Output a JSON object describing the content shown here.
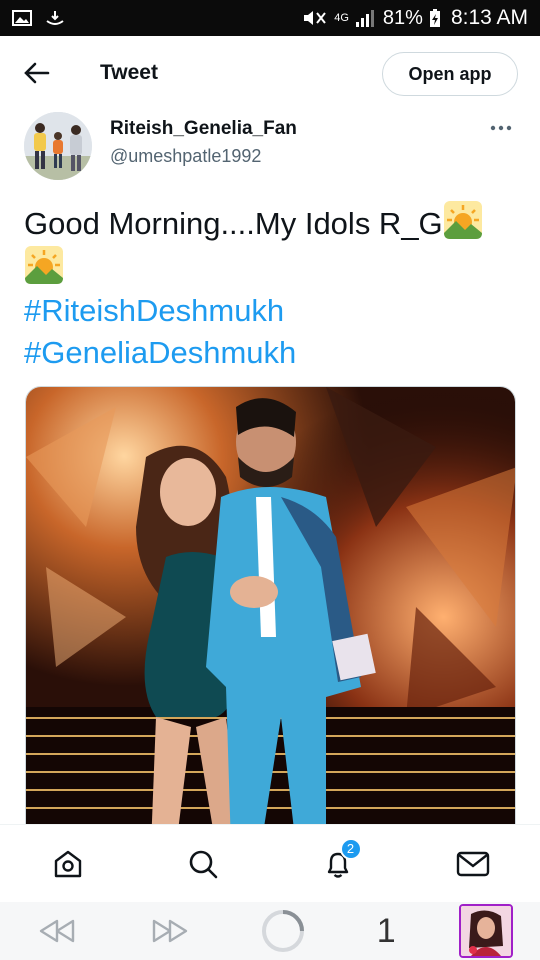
{
  "status_bar": {
    "signal_label": "4G",
    "battery_percent": "81%",
    "time": "8:13 AM"
  },
  "header": {
    "title": "Tweet",
    "open_app_label": "Open app"
  },
  "tweet": {
    "author_name": "Riteish_Genelia_Fan",
    "author_handle": "@umeshpatle1992",
    "text": "Good Morning....My Idols R_G",
    "hashtags": [
      "#RiteishDeshmukh",
      "#GeneliaDeshmukh"
    ]
  },
  "bottom_nav": {
    "items": [
      "home-icon",
      "search-icon",
      "notifications-icon",
      "messages-icon"
    ],
    "notification_count": "2"
  },
  "browser_bar": {
    "tab_count": "1"
  },
  "colors": {
    "accent": "#1d9bf0",
    "text": "#0f1419",
    "muted": "#536471",
    "status_bg": "#0b0b0b"
  }
}
